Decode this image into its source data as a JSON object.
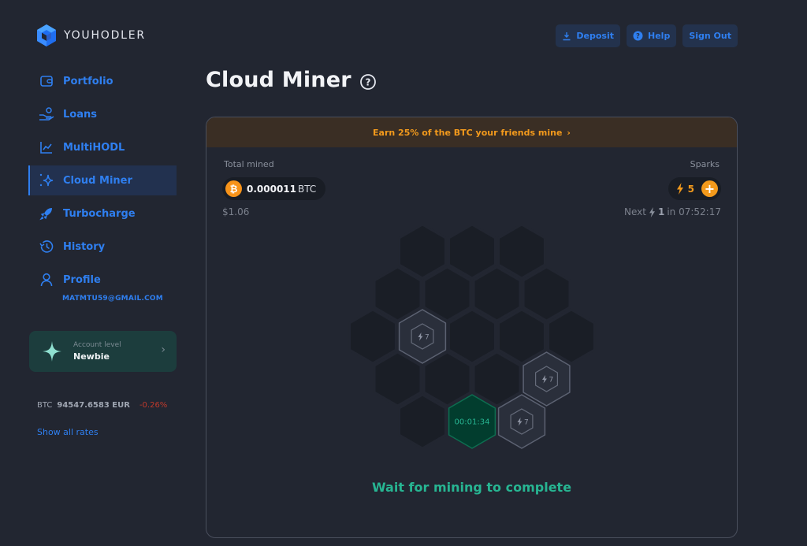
{
  "brand": {
    "name": "YOUHODLER",
    "logo_icon": "cube-logo-icon"
  },
  "header": {
    "buttons": [
      {
        "label": "Deposit",
        "icon": "download-icon"
      },
      {
        "label": "Help",
        "icon": "question-circle-icon"
      },
      {
        "label": "Sign Out"
      }
    ]
  },
  "sidebar": {
    "items": [
      {
        "label": "Portfolio",
        "icon": "wallet-icon",
        "active": false
      },
      {
        "label": "Loans",
        "icon": "hand-coin-icon",
        "active": false
      },
      {
        "label": "MultiHODL",
        "icon": "chart-line-icon",
        "active": false
      },
      {
        "label": "Cloud Miner",
        "icon": "sparkle-icon",
        "active": true
      },
      {
        "label": "Turbocharge",
        "icon": "rocket-icon",
        "active": false
      },
      {
        "label": "History",
        "icon": "history-icon",
        "active": false
      },
      {
        "label": "Profile",
        "icon": "user-icon",
        "active": false
      }
    ],
    "profile_email": "MATMTU59@GMAIL.COM",
    "account": {
      "label": "Account level",
      "value": "Newbie"
    },
    "rate": {
      "symbol": "BTC",
      "price": "94547.6583 EUR",
      "change": "-0.26%"
    },
    "show_rates": "Show all rates"
  },
  "page": {
    "title": "Cloud Miner",
    "banner": "Earn 25% of the BTC your friends mine",
    "total_mined": {
      "label": "Total mined",
      "amount": "0.000011",
      "currency": "BTC",
      "usd": "$1.06"
    },
    "sparks": {
      "label": "Sparks",
      "count": "5",
      "next_prefix": "Next",
      "next_amount": "1",
      "next_suffix": "in 07:52:17"
    },
    "hex_rows": [
      [
        {
          "state": "empty"
        },
        {
          "state": "empty"
        },
        {
          "state": "empty"
        }
      ],
      [
        {
          "state": "empty"
        },
        {
          "state": "empty"
        },
        {
          "state": "empty"
        },
        {
          "state": "empty"
        }
      ],
      [
        {
          "state": "empty"
        },
        {
          "state": "spark",
          "label": "7"
        },
        {
          "state": "empty"
        },
        {
          "state": "empty"
        },
        {
          "state": "empty"
        }
      ],
      [
        {
          "state": "empty"
        },
        {
          "state": "empty"
        },
        {
          "state": "empty"
        },
        {
          "state": "spark",
          "label": "7"
        }
      ],
      [
        {
          "state": "empty"
        },
        {
          "state": "mining",
          "label": "00:01:34"
        },
        {
          "state": "spark",
          "label": "7"
        }
      ]
    ],
    "status": "Wait for mining to complete"
  },
  "colors": {
    "accent": "#2f7ff0",
    "orange": "#f39a1c",
    "green": "#27b592",
    "bg": "#222631"
  }
}
